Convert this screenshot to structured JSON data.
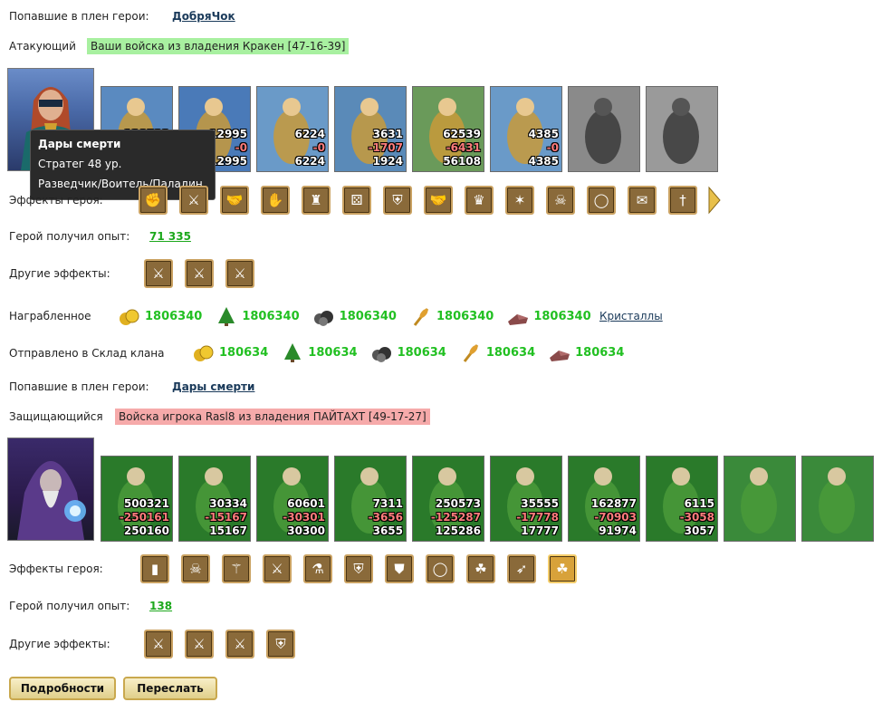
{
  "attacker": {
    "captured_label": "Попавшие в плен герои:",
    "captured_hero": "ДобряЧок",
    "role_label": "Атакующий",
    "banner": "Ваши войска из владения Кракен [47-16-39]",
    "units": [
      {
        "icon": "peasant-cart-unit",
        "c1": "128523",
        "c2": "-38206",
        "c3": "90317"
      },
      {
        "icon": "archer-unit",
        "c1": "12995",
        "c2": "-0",
        "c3": "12995"
      },
      {
        "icon": "paladin-unit",
        "c1": "6224",
        "c2": "-0",
        "c3": "6224"
      },
      {
        "icon": "griffin-unit",
        "c1": "3631",
        "c2": "-1707",
        "c3": "1924"
      },
      {
        "icon": "crossbowman-unit",
        "c1": "62539",
        "c2": "-6431",
        "c3": "56108"
      },
      {
        "icon": "priest-unit",
        "c1": "4385",
        "c2": "-0",
        "c3": "4385"
      },
      {
        "icon": "dead-knight-unit",
        "c1": "",
        "c2": "",
        "c3": ""
      },
      {
        "icon": "dead-angel-unit",
        "c1": "",
        "c2": "",
        "c3": ""
      }
    ],
    "effects_label": "Эффекты героя:",
    "effects": [
      "fist-icon",
      "sword-icon",
      "handshake-icon",
      "hand-icon",
      "tower-icon",
      "dice-icon",
      "shield-icon",
      "handshake-icon",
      "crown-icon",
      "amulet-icon",
      "demon-mask-icon",
      "ring-icon",
      "scroll-icon",
      "dagger-icon"
    ],
    "exp_label": "Герой получил опыт:",
    "exp_value": "71 335",
    "other_label": "Другие эффекты:",
    "other_effects": [
      "fist-sword-icon",
      "fist-sword-icon",
      "fist-sword-icon"
    ],
    "loot_label": "Награбленное",
    "loot": [
      "1806340",
      "1806340",
      "1806340",
      "1806340",
      "1806340"
    ],
    "loot_link": "Кристаллы",
    "clan_label": "Отправлено в Склад клана",
    "clan": [
      "180634",
      "180634",
      "180634",
      "180634",
      "180634"
    ]
  },
  "tooltip": {
    "name": "Дары смерти",
    "level": "Стратег 48 ур.",
    "classes": "Разведчик/Воитель/Паладин"
  },
  "defender": {
    "captured_label": "Попавшие в плен герои:",
    "captured_hero": "Дары смерти",
    "role_label": "Защищающийся",
    "banner": "Войска игрока Rasl8 из владения ПАЙТАХТ [49-17-27]",
    "units": [
      {
        "icon": "dwarf-unit",
        "c1": "500321",
        "c2": "-250161",
        "c3": "250160"
      },
      {
        "icon": "elf-warrior-unit",
        "c1": "30334",
        "c2": "-15167",
        "c3": "15167"
      },
      {
        "icon": "elf-spearman-unit",
        "c1": "60601",
        "c2": "-30301",
        "c3": "30300"
      },
      {
        "icon": "winged-beast-unit",
        "c1": "7311",
        "c2": "-3656",
        "c3": "3655"
      },
      {
        "icon": "elf-archer-unit",
        "c1": "250573",
        "c2": "-125287",
        "c3": "125286"
      },
      {
        "icon": "druid-unit",
        "c1": "35555",
        "c2": "-17778",
        "c3": "17777"
      },
      {
        "icon": "hooded-mage-unit",
        "c1": "162877",
        "c2": "-70903",
        "c3": "91974"
      },
      {
        "icon": "green-mage-unit",
        "c1": "6115",
        "c2": "-3058",
        "c3": "3057"
      },
      {
        "icon": "golden-tower-unit",
        "c1": "",
        "c2": "",
        "c3": ""
      },
      {
        "icon": "golden-tower-unit",
        "c1": "",
        "c2": "",
        "c3": ""
      }
    ],
    "effects_label": "Эффекты героя:",
    "effects": [
      "door-icon",
      "skull-icon",
      "staff-icon",
      "fist-sword-icon",
      "potion-icon",
      "shield-icon",
      "armor-icon",
      "ring-icon",
      "clover-icon",
      "bow-icon",
      "clover-icon"
    ],
    "exp_label": "Герой получил опыт:",
    "exp_value": "138",
    "other_label": "Другие эффекты:",
    "other_effects": [
      "fist-sword-icon",
      "fist-sword-icon",
      "fist-sword-icon",
      "shield-icon"
    ]
  },
  "buttons": {
    "details": "Подробности",
    "forward": "Переслать"
  }
}
